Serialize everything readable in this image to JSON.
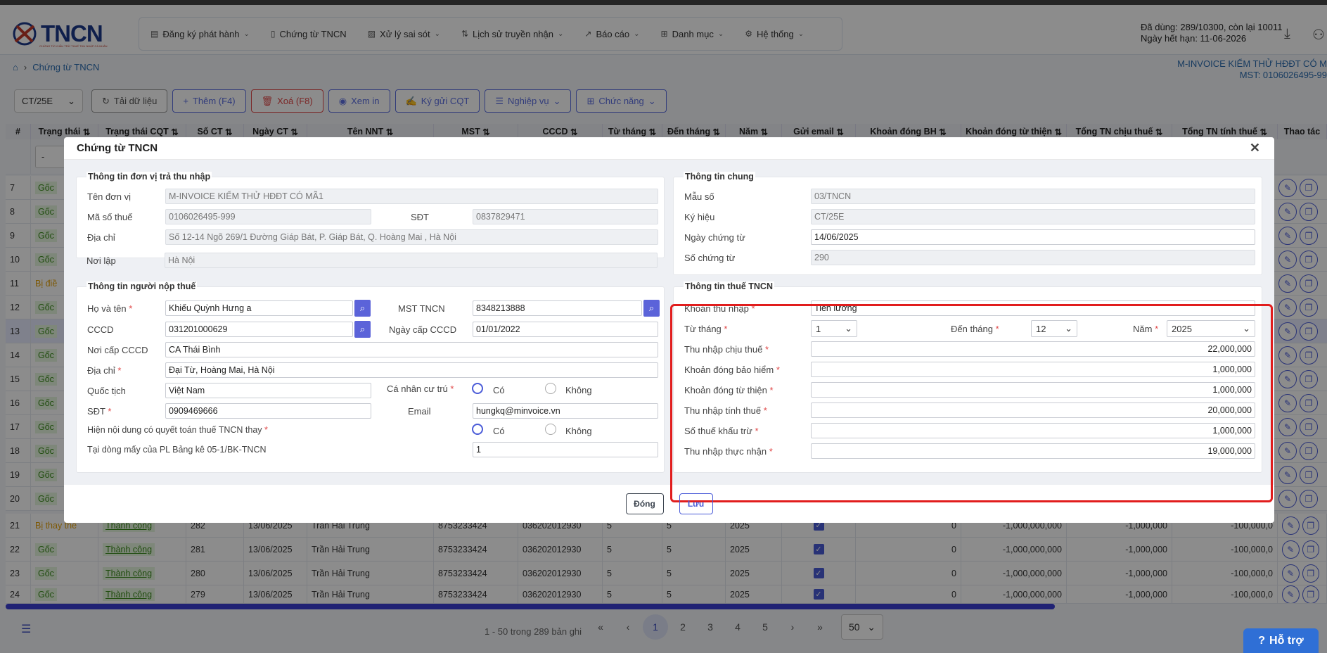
{
  "logo": {
    "text": "TNCN",
    "tagline": "CHỨNG TỪ KHẤU TRỪ THUẾ THU NHẬP CÁ NHÂN"
  },
  "menu": [
    {
      "label": "Đăng ký phát hành",
      "icon": "document-icon",
      "dropdown": true
    },
    {
      "label": "Chứng từ TNCN",
      "icon": "file-icon",
      "dropdown": false
    },
    {
      "label": "Xử lý sai sót",
      "icon": "edit-file-icon",
      "dropdown": true
    },
    {
      "label": "Lịch sử truyền nhận",
      "icon": "sort-arrows-icon",
      "dropdown": true
    },
    {
      "label": "Báo cáo",
      "icon": "chart-line-icon",
      "dropdown": true
    },
    {
      "label": "Danh mục",
      "icon": "grid-icon",
      "dropdown": true
    },
    {
      "label": "Hệ thống",
      "icon": "gear-icon",
      "dropdown": true
    }
  ],
  "quota": {
    "line1": "Đã dùng: 289/10300, còn lại 10011",
    "line2": "Ngày hết hạn: 11-06-2026"
  },
  "breadcrumb": {
    "current": "Chứng từ TNCN"
  },
  "company": {
    "name": "M-INVOICE KIỂM THỬ HĐĐT CÓ M",
    "tax": "MST: 0106026495-99"
  },
  "toolbar": {
    "series": "CT/25E",
    "reload": "Tải dữ liệu",
    "add": "Thêm (F4)",
    "delete": "Xoá (F8)",
    "print": "Xem in",
    "sign": "Ký gửi CQT",
    "operations": "Nghiệp vụ",
    "functions": "Chức năng"
  },
  "grid": {
    "headers": [
      "#",
      "Trạng thái",
      "Trạng thái CQT",
      "Số CT",
      "Ngày CT",
      "Tên NNT",
      "MST",
      "CCCD",
      "Từ tháng",
      "Đến tháng",
      "Năm",
      "Gửi email",
      "Khoản đóng BH",
      "Khoản đóng từ thiện",
      "Tổng TN chịu thuế",
      "Tổng TN tính thuế",
      "Thao tác"
    ],
    "filter_placeholder": "-",
    "rows": [
      {
        "no": "21",
        "status": "Bị thay thế",
        "cqt": "Thành công",
        "so": "282",
        "ngay": "13/06/2025",
        "ten": "Trần Hải Trung",
        "mst": "8753233424",
        "cccd": "036202012930",
        "tu": "5",
        "den": "5",
        "nam": "2025",
        "bh": "0",
        "tt": "-1,000,000,000",
        "chiu": "-1,000,000",
        "tinh": "-100,000,0"
      },
      {
        "no": "22",
        "status": "Gốc",
        "cqt": "Thành công",
        "so": "281",
        "ngay": "13/06/2025",
        "ten": "Trần Hải Trung",
        "mst": "8753233424",
        "cccd": "036202012930",
        "tu": "5",
        "den": "5",
        "nam": "2025",
        "bh": "0",
        "tt": "-1,000,000,000",
        "chiu": "-1,000,000",
        "tinh": "-100,000,0"
      },
      {
        "no": "23",
        "status": "Gốc",
        "cqt": "Thành công",
        "so": "280",
        "ngay": "13/06/2025",
        "ten": "Trần Hải Trung",
        "mst": "8753233424",
        "cccd": "036202012930",
        "tu": "5",
        "den": "5",
        "nam": "2025",
        "bh": "0",
        "tt": "-1,000,000,000",
        "chiu": "-1,000,000",
        "tinh": "-100,000,0"
      },
      {
        "no": "24",
        "status": "Gốc",
        "cqt": "Thành công",
        "so": "279",
        "ngay": "13/06/2025",
        "ten": "Trần Hải Trung",
        "mst": "8753233424",
        "cccd": "036202012930",
        "tu": "5",
        "den": "5",
        "nam": "2025",
        "bh": "0",
        "tt": "-1,000,000,000",
        "chiu": "-1,000,000",
        "tinh": "-100,000,0"
      }
    ],
    "left_rows": [
      {
        "no": "7",
        "status": "Gốc"
      },
      {
        "no": "8",
        "status": "Gốc"
      },
      {
        "no": "9",
        "status": "Gốc"
      },
      {
        "no": "10",
        "status": "Gốc"
      },
      {
        "no": "11",
        "status": "Bị điề"
      },
      {
        "no": "12",
        "status": "Gốc"
      },
      {
        "no": "13",
        "status": "Gốc"
      },
      {
        "no": "14",
        "status": "Gốc"
      },
      {
        "no": "15",
        "status": "Gốc"
      },
      {
        "no": "16",
        "status": "Gốc"
      },
      {
        "no": "17",
        "status": "Gốc"
      },
      {
        "no": "18",
        "status": "Gốc"
      },
      {
        "no": "19",
        "status": "Gốc"
      },
      {
        "no": "20",
        "status": "Gốc"
      }
    ]
  },
  "pager": {
    "info": "1 - 50 trong 289 bản ghi",
    "pages": [
      "1",
      "2",
      "3",
      "4",
      "5"
    ],
    "size": "50"
  },
  "help": "Hỗ trợ",
  "modal": {
    "title": "Chứng từ TNCN",
    "payer": {
      "title": "Thông tin đơn vị trả thu nhập",
      "name_label": "Tên đơn vị",
      "name": "M-INVOICE KIỂM THỬ HĐĐT CÓ MÃ1",
      "tax_label": "Mã số thuế",
      "tax": "0106026495-999",
      "phone_label": "SĐT",
      "phone": "0837829471",
      "addr_label": "Địa chỉ",
      "addr": "Số 12-14 Ngõ 269/1 Đường Giáp Bát, P. Giáp Bát, Q. Hoàng Mai , Hà Nội",
      "place_label": "Nơi lập",
      "place": "Hà Nội"
    },
    "general": {
      "title": "Thông tin chung",
      "form_label": "Mẫu số",
      "form": "03/TNCN",
      "symbol_label": "Ký hiệu",
      "symbol": "CT/25E",
      "date_label": "Ngày chứng từ",
      "date": "14/06/2025",
      "number_label": "Số chứng từ",
      "number": "290"
    },
    "taxpayer": {
      "title": "Thông tin người nộp thuế",
      "name_label": "Họ và tên",
      "name": "Khiếu Quỳnh Hưng a",
      "mst_label": "MST TNCN",
      "mst": "8348213888",
      "cccd_label": "CCCD",
      "cccd": "031201000629",
      "cccd_date_label": "Ngày cấp CCCD",
      "cccd_date": "01/01/2022",
      "cccd_place_label": "Nơi cấp CCCD",
      "cccd_place": "CA Thái Bình",
      "addr_label": "Địa chỉ",
      "addr": "Đại Từ, Hoàng Mai, Hà Nội",
      "nation_label": "Quốc tịch",
      "nation": "Việt Nam",
      "resident_label": "Cá nhân cư trú",
      "yes": "Có",
      "no": "Không",
      "phone_label": "SĐT",
      "phone": "0909469666",
      "email_label": "Email",
      "email": "hungkq@minvoice.vn",
      "settle_label": "Hiện nội dung có quyết toán thuế TNCN thay",
      "line_label": "Tại dòng mấy của PL Bảng kê 05-1/BK-TNCN",
      "line": "1"
    },
    "taxinfo": {
      "title": "Thông tin thuế TNCN",
      "income_label": "Khoản thu nhập",
      "income": "Tiền lương",
      "from_label": "Từ tháng",
      "from": "1",
      "to_label": "Đến tháng",
      "to": "12",
      "year_label": "Năm",
      "year": "2025",
      "taxable_label": "Thu nhập chịu thuế",
      "taxable": "22,000,000",
      "insurance_label": "Khoản đóng bảo hiểm",
      "insurance": "1,000,000",
      "charity_label": "Khoản đóng từ thiện",
      "charity": "1,000,000",
      "assessable_label": "Thu nhập tính thuế",
      "assessable": "20,000,000",
      "withheld_label": "Số thuế khấu trừ",
      "withheld": "1,000,000",
      "net_label": "Thu nhập thực nhận",
      "net": "19,000,000"
    },
    "close_btn": "Đóng",
    "save_btn": "Lưu"
  }
}
